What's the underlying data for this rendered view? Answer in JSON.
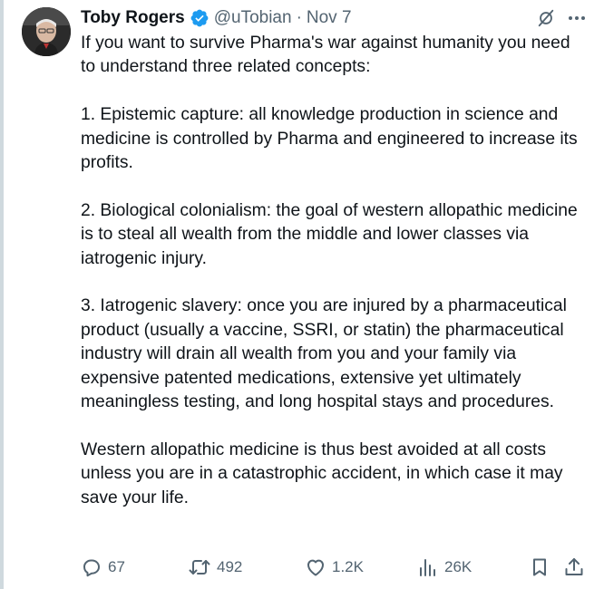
{
  "author": {
    "display_name": "Toby Rogers",
    "handle": "@uTobian",
    "separator": "·",
    "date": "Nov 7",
    "verified": true,
    "verified_color": "#1d9bf0"
  },
  "tweet": {
    "paragraphs": [
      "If you want to survive Pharma's war against humanity you need to understand three related concepts:",
      "1. Epistemic capture: all knowledge production in science and medicine is controlled by Pharma and engineered to increase its profits.",
      "2. Biological colonialism: the goal of western allopathic medicine is to steal all wealth from the middle and lower classes via iatrogenic injury.",
      "3. Iatrogenic slavery: once you are injured by a pharmaceutical product (usually a vaccine, SSRI, or statin) the pharmaceutical industry will drain all wealth from you and your family via expensive patented medications, extensive yet ultimately meaningless testing, and long hospital stays and procedures.",
      "Western allopathic medicine is thus best avoided at all costs unless you are in a catastrophic accident, in which case it may save your life."
    ]
  },
  "actions": {
    "replies": "67",
    "reposts": "492",
    "likes": "1.2K",
    "views": "26K"
  },
  "icons": {
    "header": [
      "grok-icon",
      "more-options-icon"
    ],
    "actions": [
      "reply-icon",
      "repost-icon",
      "like-icon",
      "views-icon",
      "bookmark-icon",
      "share-icon"
    ]
  },
  "colors": {
    "text": "#0f1419",
    "secondary": "#536471",
    "verified": "#1d9bf0"
  }
}
